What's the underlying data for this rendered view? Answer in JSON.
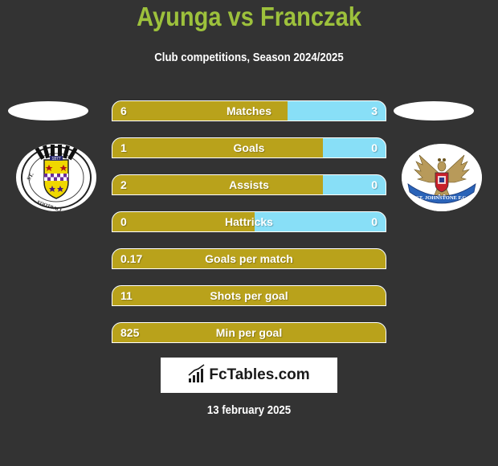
{
  "header": {
    "title": "Ayunga vs Franczak",
    "subtitle": "Club competitions, Season 2024/2025"
  },
  "teams": {
    "left": {
      "player": "Ayunga",
      "club_logo": "st-mirren-fc-crest",
      "logo_text": "ST. MIRREN FOOTBALL CLUB",
      "logo_year": "1877"
    },
    "right": {
      "player": "Franczak",
      "club_logo": "st-johnstone-fc-crest",
      "logo_text": "ST. JOHNSTONE F.C."
    }
  },
  "colors": {
    "background": "#333333",
    "title": "#9dc13c",
    "left_bar": "#b9a21b",
    "right_bar": "#88dff7",
    "text": "#ffffff"
  },
  "stats": [
    {
      "label": "Matches",
      "left": "6",
      "right": "3",
      "left_share": 0.64
    },
    {
      "label": "Goals",
      "left": "1",
      "right": "0",
      "left_share": 0.77
    },
    {
      "label": "Assists",
      "left": "2",
      "right": "0",
      "left_share": 0.77
    },
    {
      "label": "Hattricks",
      "left": "0",
      "right": "0",
      "left_share": 0.52
    },
    {
      "label": "Goals per match",
      "left": "0.17",
      "right": "",
      "left_share": 1.0
    },
    {
      "label": "Shots per goal",
      "left": "11",
      "right": "",
      "left_share": 1.0
    },
    {
      "label": "Min per goal",
      "left": "825",
      "right": "",
      "left_share": 1.0
    }
  ],
  "footer": {
    "brand": "FcTables.com",
    "brand_icon": "bar-chart-trend-icon",
    "date": "13 february 2025"
  }
}
